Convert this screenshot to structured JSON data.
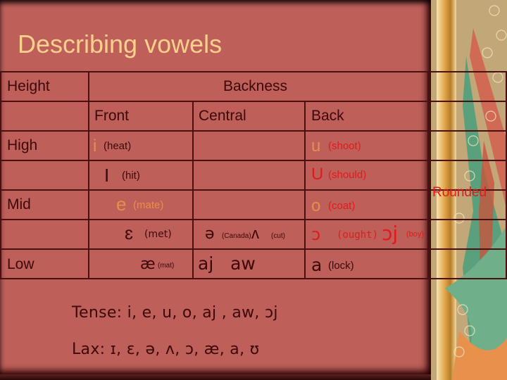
{
  "slide": {
    "title": "Describing vowels",
    "colors": {
      "background": "#be5f5a",
      "title": "#fdd08c",
      "text": "#3c0808",
      "tense_vowel": "#e98d4e",
      "lax_highlight": "#e21a1a"
    }
  },
  "table": {
    "header": {
      "height": "Height",
      "backness": "Backness"
    },
    "columns": {
      "front": "Front",
      "central": "Central",
      "back": "Back"
    },
    "height_labels": {
      "high": "High",
      "mid": "Mid",
      "low": "Low"
    },
    "rows": [
      {
        "front": {
          "symbol": "i",
          "gloss": "(heat)"
        },
        "central": null,
        "back": {
          "symbol": "u",
          "gloss": "(shoot)"
        }
      },
      {
        "front": {
          "symbol": "I",
          "gloss": "(hit)"
        },
        "central": null,
        "back": {
          "symbol": "U",
          "gloss": "(should)"
        }
      },
      {
        "front": {
          "symbol": "e",
          "gloss": "(mate)"
        },
        "central": null,
        "back": {
          "symbol": "o",
          "gloss": "(coat)"
        }
      },
      {
        "front": {
          "symbol": "ɛ",
          "gloss": "(met)"
        },
        "central": {
          "symbol1": "ə",
          "gloss1": "(Canada)",
          "symbol2": "ʌ",
          "gloss2": "(cut)"
        },
        "back": {
          "symbol1": "ɔ",
          "gloss1": "(ought)",
          "symbol2": "ɔj",
          "gloss2": "(boy)"
        }
      },
      {
        "front": {
          "symbol": "æ",
          "gloss": "(mat)"
        },
        "central": {
          "symbol": "aj   aw"
        },
        "back": {
          "symbol": "a",
          "gloss": "(lock)"
        }
      }
    ],
    "rounded_label": "Rounded"
  },
  "notes": {
    "tense": "Tense: i, e, u, o, aj , aw, ɔj",
    "lax": "Lax: ɪ, ɛ, ə, ʌ, ɔ, æ, a, ʊ"
  }
}
